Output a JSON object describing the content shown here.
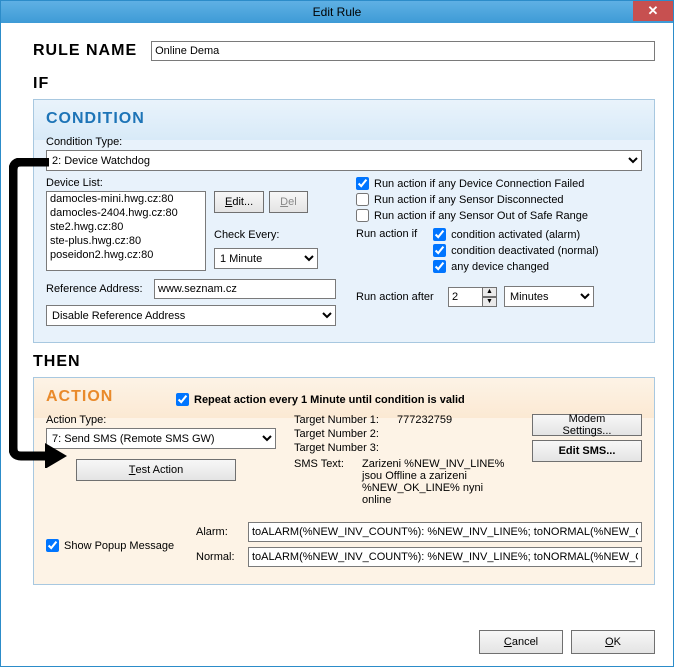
{
  "window": {
    "title": "Edit Rule"
  },
  "rule_name_label": "RULE NAME",
  "rule_name_value": "Online Dema",
  "if_label": "IF",
  "then_label": "THEN",
  "condition": {
    "heading": "CONDITION",
    "type_label": "Condition Type:",
    "type_value": "2: Device Watchdog",
    "device_list_label": "Device List:",
    "devices": [
      "damocles-mini.hwg.cz:80",
      "damocles-2404.hwg.cz:80",
      "ste2.hwg.cz:80",
      "ste-plus.hwg.cz:80",
      "poseidon2.hwg.cz:80"
    ],
    "edit_btn": "Edit...",
    "del_btn": "Del",
    "check_every_label": "Check Every:",
    "check_every_value": "1 Minute",
    "ref_addr_label": "Reference Address:",
    "ref_addr_value": "www.seznam.cz",
    "ref_addr_mode": "Disable Reference Address",
    "opt_conn_failed": "Run action if any Device Connection Failed",
    "opt_sensor_disc": "Run action if any Sensor Disconnected",
    "opt_sensor_range": "Run action if any Sensor Out of Safe Range",
    "run_if_label": "Run action if",
    "run_if_alarm": "condition activated (alarm)",
    "run_if_normal": "condition deactivated (normal)",
    "run_if_changed": "any device changed",
    "run_after_label": "Run action after",
    "run_after_value": "2",
    "run_after_unit": "Minutes"
  },
  "action": {
    "heading": "ACTION",
    "repeat_label": "Repeat action every 1 Minute until condition is valid",
    "type_label": "Action Type:",
    "type_value": "7: Send SMS (Remote SMS GW)",
    "test_btn": "Test Action",
    "target1_label": "Target Number 1:",
    "target1_value": "777232759",
    "target2_label": "Target Number 2:",
    "target3_label": "Target Number 3:",
    "sms_text_label": "SMS Text:",
    "sms_text_value": "Zarizeni %NEW_INV_LINE% jsou Offline a zarizeni %NEW_OK_LINE% nyni online",
    "modem_btn": "Modem Settings...",
    "edit_sms_btn": "Edit SMS...",
    "show_popup": "Show Popup Message",
    "alarm_label": "Alarm:",
    "alarm_value": "toALARM(%NEW_INV_COUNT%): %NEW_INV_LINE%; toNORMAL(%NEW_OK_COUNT%): %NEW_OK_LINE%",
    "normal_label": "Normal:",
    "normal_value": "toALARM(%NEW_INV_COUNT%): %NEW_INV_LINE%; toNORMAL(%NEW_OK_COUNT%): %NEW_OK_LINE%"
  },
  "footer": {
    "cancel": "Cancel",
    "ok": "OK"
  }
}
